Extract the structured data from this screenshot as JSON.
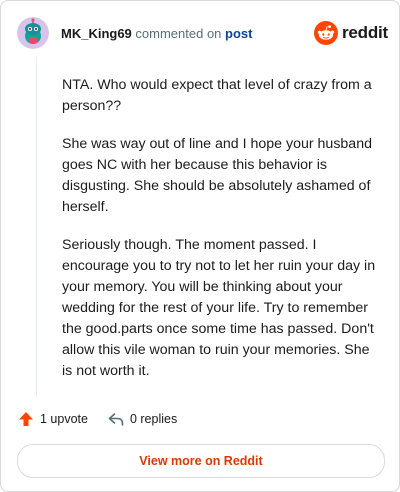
{
  "header": {
    "username": "MK_King69",
    "action_text": "commented on",
    "post_link": "post",
    "brand": "reddit"
  },
  "comment": {
    "paragraphs": [
      "NTA. Who would expect that level of crazy from a person??",
      "She was way out of line and I hope your husband goes NC with her because this behavior is disgusting. She should be absolutely ashamed of herself.",
      "Seriously though. The moment passed. I encourage you to try not to let her ruin your day in your memory. You will be thinking about your wedding for the rest of your life. Try to remember the good.parts once some time has passed. Don't allow this vile woman to ruin your memories. She is not worth it."
    ]
  },
  "actions": {
    "upvote_label": "1 upvote",
    "reply_label": "0 replies"
  },
  "footer": {
    "view_more_label": "View more on Reddit"
  },
  "colors": {
    "accent": "#d93a00",
    "upvote": "#ff4500",
    "link": "#0a449b"
  }
}
